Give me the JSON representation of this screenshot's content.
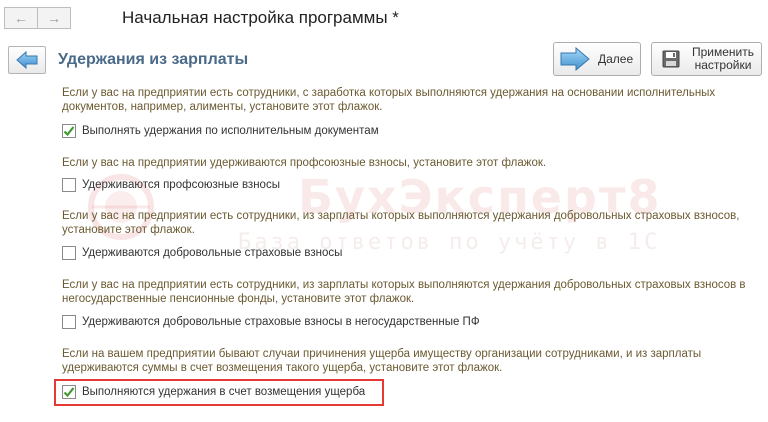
{
  "window": {
    "title": "Начальная настройка программы *",
    "back_arrow": "←",
    "forward_arrow": "→"
  },
  "header": {
    "title": "Удержания из зарплаты",
    "next_label": "Далее",
    "apply_label_line1": "Применить",
    "apply_label_line2": "настройки"
  },
  "sections": [
    {
      "description": "Если у вас на предприятии есть сотрудники, с заработка которых выполняются удержания на основании исполнительных документов, например, алименты, установите этот флажок.",
      "checkbox_label": "Выполнять удержания по исполнительным документам",
      "checked": true
    },
    {
      "description": "Если у вас на предприятии удерживаются профсоюзные взносы, установите этот флажок.",
      "checkbox_label": "Удерживаются профсоюзные взносы",
      "checked": false
    },
    {
      "description": "Если у вас на предприятии есть сотрудники, из зарплаты которых выполняются удержания добровольных страховых взносов, установите этот флажок.",
      "checkbox_label": "Удерживаются добровольные страховые взносы",
      "checked": false
    },
    {
      "description": "Если у вас на предприятии есть сотрудники, из зарплаты которых выполняются удержания добровольных страховых взносов в негосударственные пенсионные фонды, установите этот флажок.",
      "checkbox_label": "Удерживаются добровольные страховые взносы в негосударственные ПФ",
      "checked": false
    },
    {
      "description": "Если на вашем предприятии бывают случаи причинения ущерба имуществу организации сотрудниками, и из зарплаты удерживаются суммы в счет возмещения такого ущерба, установите этот флажок.",
      "checkbox_label": "Выполняются удержания в счет возмещения ущерба",
      "checked": true
    }
  ],
  "watermark": {
    "title": "БухЭксперт8",
    "subtitle": "База ответов по учёту в 1С"
  },
  "colors": {
    "section_title": "#4a6a8a",
    "description_text": "#6b5a31",
    "check_mark": "#3f9a2f",
    "highlight_border": "#e53935"
  },
  "icons": {
    "back_button": "arrow-left-icon",
    "next_button": "arrow-right-icon",
    "apply_button": "floppy-disk-icon",
    "checkbox_checked": "check-icon"
  }
}
